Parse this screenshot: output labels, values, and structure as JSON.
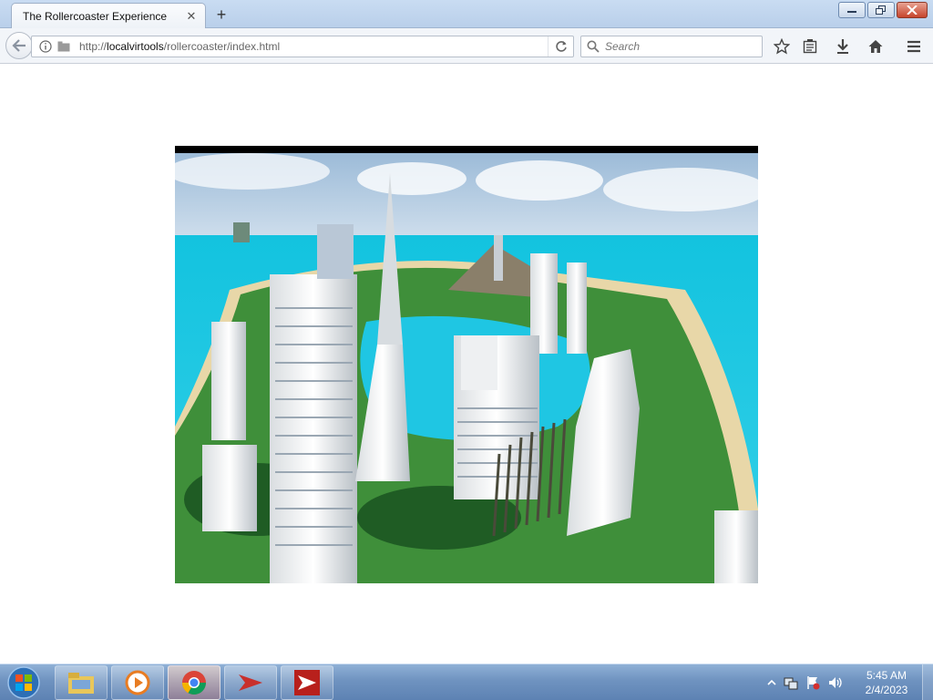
{
  "browser": {
    "tab_title": "The Rollercoaster Experience",
    "tab_close": "✕",
    "new_tab": "+",
    "url_prefix": "http://",
    "url_host": "localvirtools",
    "url_path": "/rollercoaster/index.html",
    "search_placeholder": "Search"
  },
  "scene": {
    "icons": [
      "info-icon",
      "reload-icon",
      "search-icon",
      "bookmark-star-icon",
      "reading-list-icon",
      "download-icon",
      "home-icon",
      "menu-icon"
    ]
  },
  "taskbar": {
    "items": [
      "file-explorer",
      "media-player",
      "chrome",
      "app-red-arrow",
      "app-red-arrow-web"
    ],
    "time": "5:45 AM",
    "date": "2/4/2023"
  },
  "colors": {
    "sea": "#1fc6e3",
    "sky": "#a9c9e6",
    "grass": "#3f8f3a",
    "accent_red": "#c9302c"
  }
}
